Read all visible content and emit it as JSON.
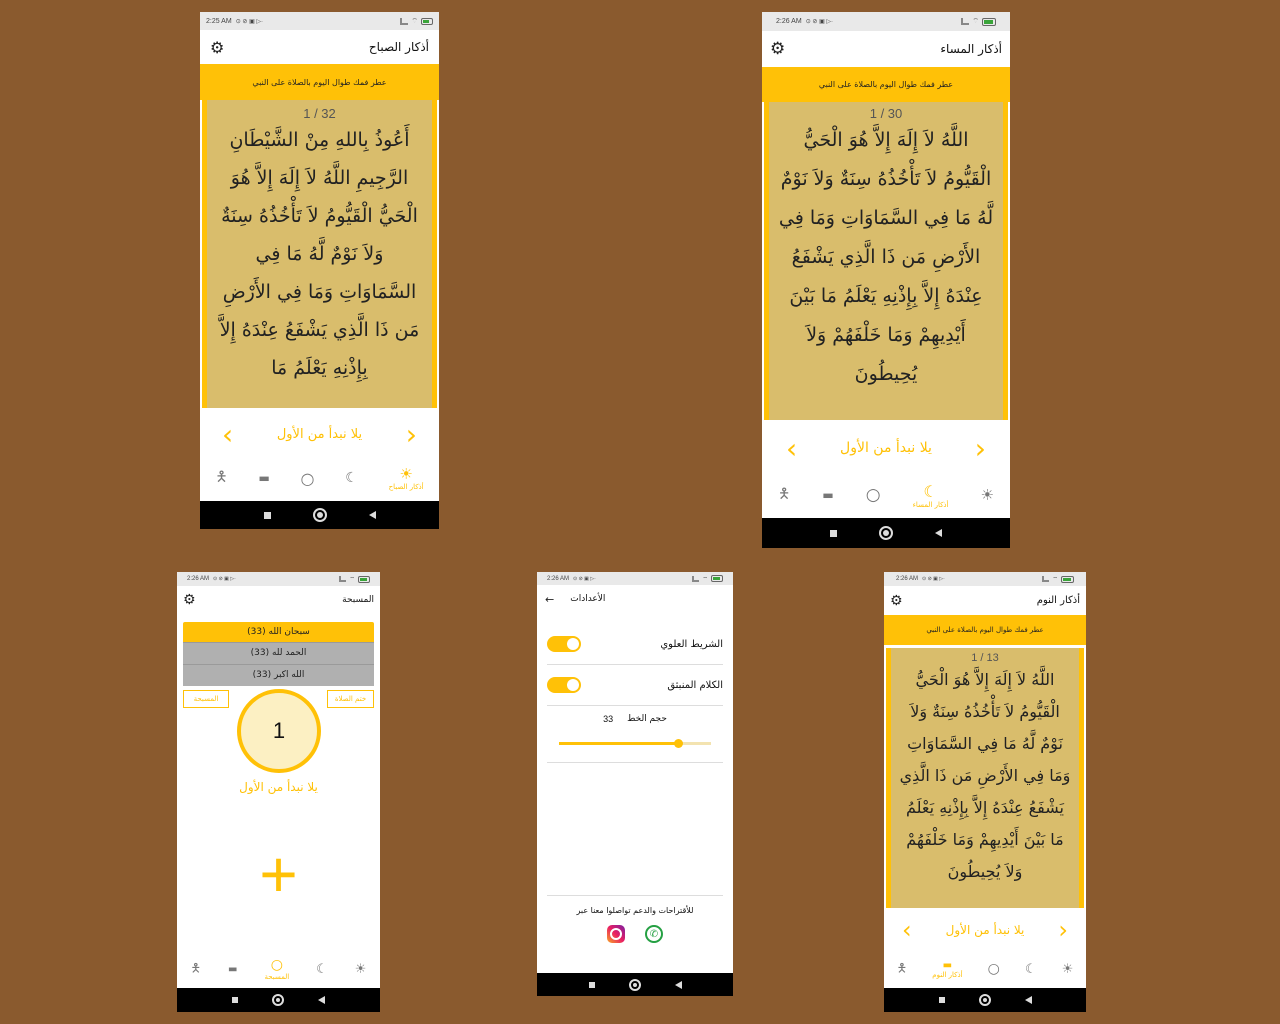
{
  "colors": {
    "background": "#8a5a2e",
    "accent": "#ffc107",
    "card": "#d9bd6c"
  },
  "status": {
    "time_0225": "2:25 AM",
    "time_0226": "2:26 AM"
  },
  "common": {
    "banner": "عطر فمك طوال اليوم بالصلاة على النبي",
    "restart": "يلا نبدأ من الأول",
    "prev": "‹",
    "next": "›",
    "gear": "⚙"
  },
  "morning": {
    "title": "أذكار الصباح",
    "counter": "1 / 32",
    "text": "أَعُوذُ بِاللهِ مِنْ الشَّيْطَانِ الرَّجِيمِ اللَّهُ لاَ إِلَهَ إِلاَّ هُوَ الْحَيُّ الْقَيُّومُ لاَ تَأْخُذُهُ سِنَةٌ وَلاَ نَوْمٌ لَّهُ مَا فِي السَّمَاوَاتِ وَمَا فِي الأَرْضِ مَن ذَا الَّذِي يَشْفَعُ عِنْدَهُ إِلاَّ بِإِذْنِهِ يَعْلَمُ مَا",
    "tab_label": "أذكار الصباح"
  },
  "evening": {
    "title": "أذكار المساء",
    "counter": "1 / 30",
    "text": "اللَّهُ لاَ إِلَهَ إِلاَّ هُوَ الْحَيُّ الْقَيُّومُ لاَ تَأْخُذُهُ سِنَةٌ وَلاَ نَوْمٌ لَّهُ مَا فِي السَّمَاوَاتِ وَمَا فِي الأَرْضِ مَن ذَا الَّذِي يَشْفَعُ عِنْدَهُ إِلاَّ بِإِذْنِهِ يَعْلَمُ مَا بَيْنَ أَيْدِيهِمْ وَمَا خَلْفَهُمْ وَلاَ يُحِيطُونَ",
    "tab_label": "أذكار المساء"
  },
  "tasbih": {
    "title": "المسبحة",
    "items": [
      "سبحان الله (33)",
      "الحمد لله (33)",
      "الله اكبر (33)"
    ],
    "left_button": "المسبحة",
    "right_button": "ختم الصلاة",
    "count": "1",
    "plus": "+",
    "tab_label": "المسبحة"
  },
  "settings": {
    "title": "الأعدادات",
    "back": "←",
    "top_bar_label": "الشريط العلوي",
    "popup_label": "الكلام المنبثق",
    "font_size_label": "حجم الخط",
    "font_size_value": "33",
    "font_size_fraction": 0.78,
    "contact_text": "للأقتراحات والدعم تواصلوا معنا عبر"
  },
  "sleep": {
    "title": "أذكار النوم",
    "counter": "1 / 13",
    "text": "اللَّهُ لاَ إِلَهَ إِلاَّ هُوَ الْحَيُّ الْقَيُّومُ لاَ تَأْخُذُهُ سِنَةٌ وَلاَ نَوْمٌ لَّهُ مَا فِي السَّمَاوَاتِ وَمَا فِي الأَرْضِ مَن ذَا الَّذِي يَشْفَعُ عِنْدَهُ إِلاَّ بِإِذْنِهِ يَعْلَمُ مَا بَيْنَ أَيْدِيهِمْ وَمَا خَلْفَهُمْ وَلاَ يُحِيطُونَ",
    "tab_label": "أذكار النوم"
  },
  "icons": {
    "prayer": "prayer-person-icon",
    "sleep": "bed-icon",
    "tasbih": "circle-icon",
    "evening": "moon-icon",
    "morning": "sun-icon",
    "gear": "gear-icon",
    "instagram": "instagram-icon",
    "whatsapp": "whatsapp-icon"
  }
}
